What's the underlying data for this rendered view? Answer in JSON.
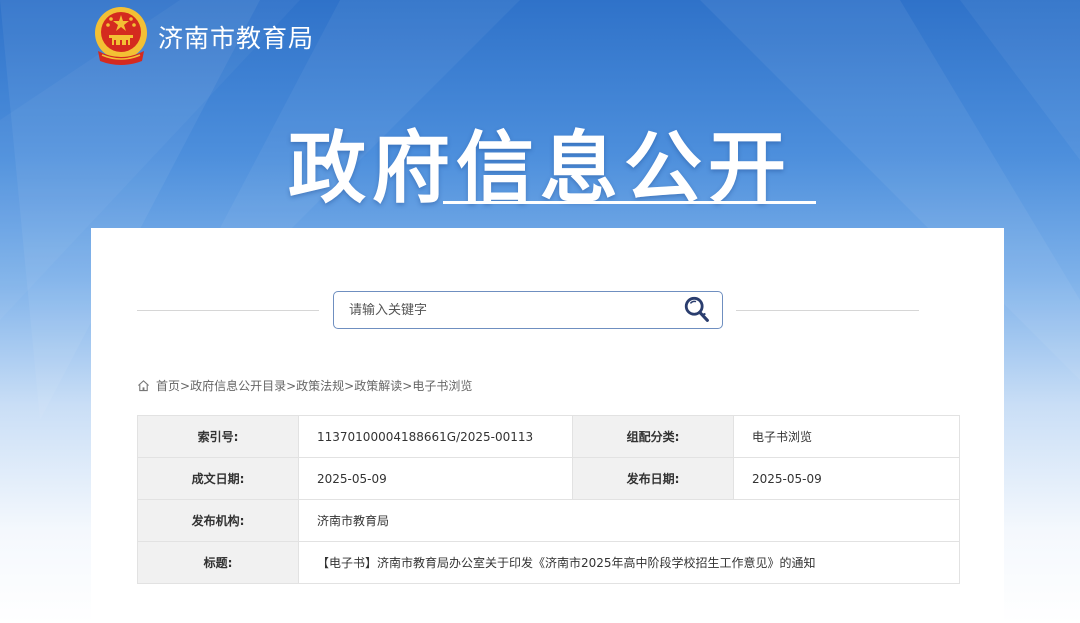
{
  "header": {
    "site_name": "济南市教育局"
  },
  "hero": {
    "title": "政府信息公开"
  },
  "search": {
    "placeholder": "请输入关键字"
  },
  "breadcrumb": {
    "items": [
      "首页",
      "政府信息公开目录",
      "政策法规",
      "政策解读",
      "电子书浏览"
    ],
    "separator": ">"
  },
  "info": {
    "index_label": "索引号:",
    "index_value": "11370100004188661G/2025-00113",
    "category_label": "组配分类:",
    "category_value": "电子书浏览",
    "created_label": "成文日期:",
    "created_value": "2025-05-09",
    "published_label": "发布日期:",
    "published_value": "2025-05-09",
    "agency_label": "发布机构:",
    "agency_value": "济南市教育局",
    "title_label": "标题:",
    "title_value": "【电子书】济南市教育局办公室关于印发《济南市2025年高中阶段学校招生工作意见》的通知"
  },
  "colors": {
    "banner_top": "#2f72c9",
    "emblem_red": "#d42a1f",
    "emblem_gold": "#f3c034",
    "search_border": "#6f8fc0"
  },
  "icons": {
    "search": "search-icon",
    "home": "home-icon",
    "emblem": "national-emblem-icon"
  }
}
